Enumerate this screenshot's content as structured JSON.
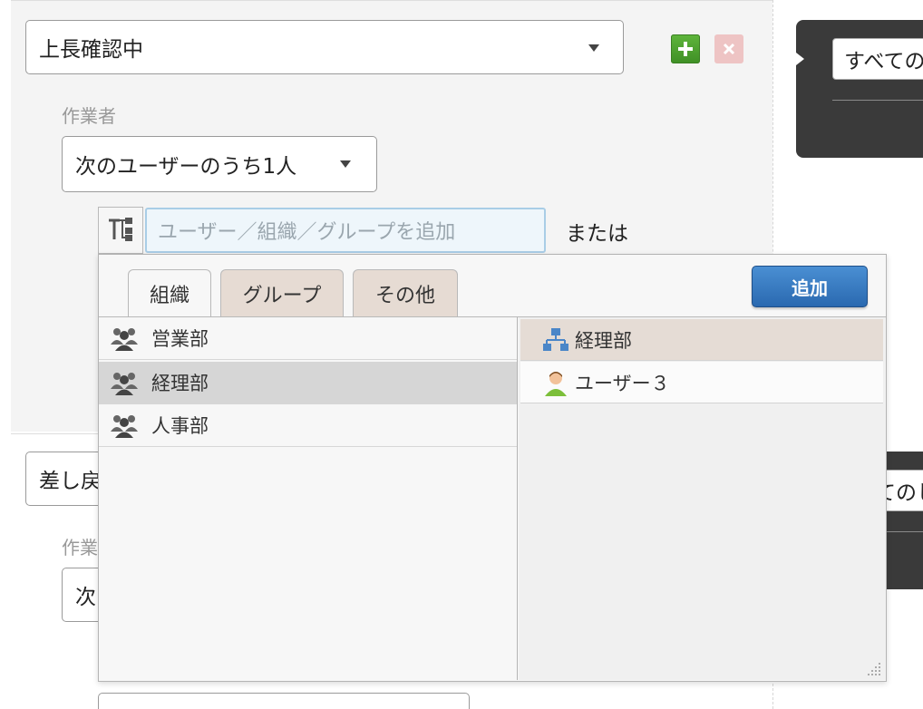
{
  "step1": {
    "status_select": "上長確認中",
    "worker_label": "作業者",
    "worker_select": "次のユーザーのうち1人",
    "picker_placeholder": "ユーザー／組織／グループを追加",
    "or_text": "または",
    "add_icon": "plus-icon",
    "delete_icon": "x-icon"
  },
  "step2": {
    "status_select_partial": "差し戻",
    "worker_label_partial": "作業",
    "worker_select_partial": "次"
  },
  "right_panel": {
    "condition_select_top": "すべての",
    "condition_select_bottom": "てのし"
  },
  "dropdown": {
    "tabs": [
      {
        "label": "組織",
        "active": true
      },
      {
        "label": "グループ",
        "active": false
      },
      {
        "label": "その他",
        "active": false
      }
    ],
    "add_button": "追加",
    "organizations": [
      {
        "name": "営業部",
        "icon": "group-icon",
        "selected": false
      },
      {
        "name": "経理部",
        "icon": "group-icon",
        "selected": true
      },
      {
        "name": "人事部",
        "icon": "group-icon",
        "selected": false
      }
    ],
    "members": [
      {
        "name": "経理部",
        "icon": "org-chart-icon"
      },
      {
        "name": "ユーザー３",
        "icon": "user-icon"
      }
    ]
  },
  "colors": {
    "accent_blue": "#2a69b0",
    "add_green": "#4ca22f",
    "delete_pink": "#eec4c4",
    "dark_panel": "#3a3a3a"
  }
}
